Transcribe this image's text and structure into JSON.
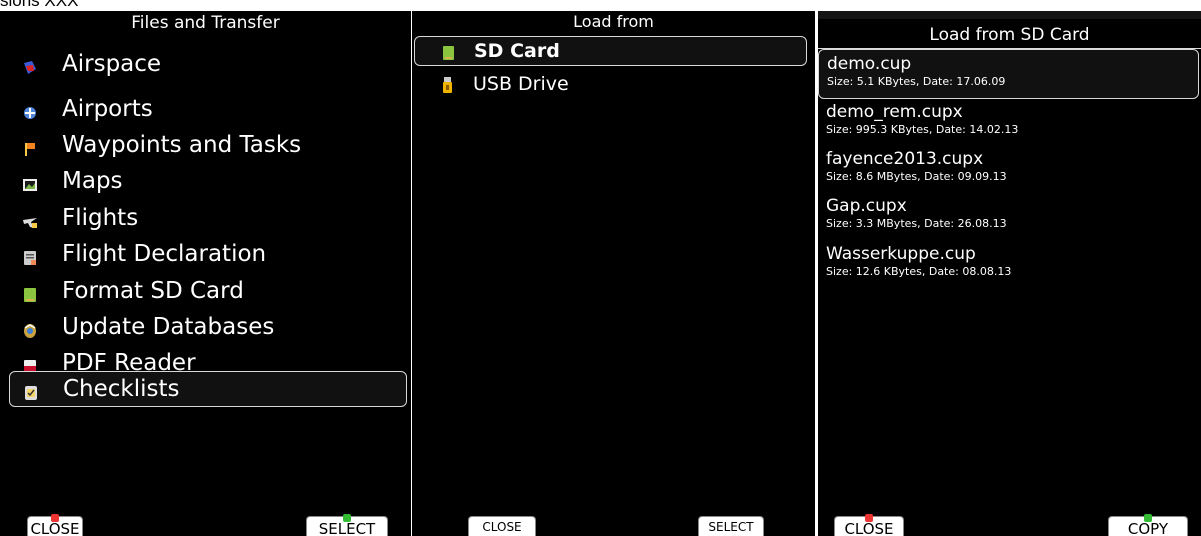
{
  "caption": "sions XXX",
  "panel1": {
    "title": "Files and Transfer",
    "items": [
      {
        "label": "Airspace",
        "icon": "airspace-icon"
      },
      {
        "label": "Airports",
        "icon": "airport-icon"
      },
      {
        "label": "Waypoints and Tasks",
        "icon": "waypoint-flag-icon"
      },
      {
        "label": "Maps",
        "icon": "map-icon"
      },
      {
        "label": "Flights",
        "icon": "flights-icon"
      },
      {
        "label": "Flight Declaration",
        "icon": "declaration-icon"
      },
      {
        "label": "Format SD Card",
        "icon": "sd-card-icon"
      },
      {
        "label": "Update Databases",
        "icon": "update-database-icon"
      },
      {
        "label": "PDF Reader",
        "icon": "pdf-icon"
      },
      {
        "label": "Checklists",
        "icon": "checklist-icon"
      }
    ],
    "selected_index": 9,
    "close_label": "CLOSE",
    "select_label": "SELECT"
  },
  "panel2": {
    "title": "Load from",
    "items": [
      {
        "label": "SD Card",
        "icon": "sd-card-icon"
      },
      {
        "label": "USB Drive",
        "icon": "usb-drive-icon"
      }
    ],
    "selected_index": 0,
    "close_label": "CLOSE",
    "select_label": "SELECT"
  },
  "panel3": {
    "title": "Load from SD Card",
    "files": [
      {
        "name": "demo.cup",
        "info": "Size: 5.1 KBytes, Date: 17.06.09"
      },
      {
        "name": "demo_rem.cupx",
        "info": "Size: 995.3 KBytes, Date: 14.02.13"
      },
      {
        "name": "fayence2013.cupx",
        "info": "Size: 8.6 MBytes, Date: 09.09.13"
      },
      {
        "name": "Gap.cupx",
        "info": "Size: 3.3 MBytes, Date: 26.08.13"
      },
      {
        "name": "Wasserkuppe.cup",
        "info": "Size: 12.6 KBytes, Date: 08.08.13"
      }
    ],
    "selected_index": 0,
    "close_label": "CLOSE",
    "copy_label": "COPY"
  },
  "colors": {
    "background": "#000000",
    "text": "#ffffff",
    "selection_border": "#d8d8d8",
    "close_mark": "#ee3333",
    "ok_mark": "#33bb33"
  }
}
